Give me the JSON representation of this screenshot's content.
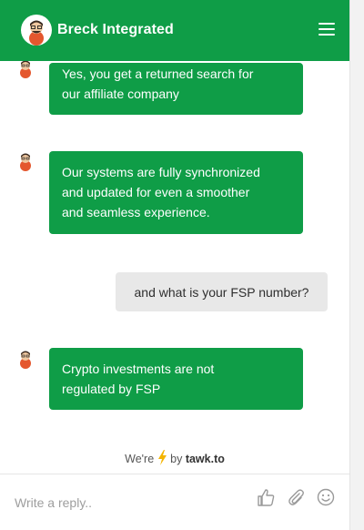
{
  "header": {
    "title": "Breck Integrated",
    "menu_icon": "hamburger-menu-icon"
  },
  "messages": [
    {
      "from": "agent",
      "text_lines": [
        "Yes, you get a returned search for",
        "our affiliate company"
      ]
    },
    {
      "from": "agent",
      "text_lines": [
        "Our systems are fully synchronized",
        "and updated for even a smoother",
        "and seamless experience."
      ]
    },
    {
      "from": "visitor",
      "text_lines": [
        "and what is your FSP  number?"
      ]
    },
    {
      "from": "agent",
      "text_lines": [
        "Crypto investments are  not",
        "regulated by FSP"
      ]
    }
  ],
  "powered_by": {
    "prefix": "We're",
    "by": "by",
    "brand": "tawk.to"
  },
  "composer": {
    "placeholder": "Write a reply..",
    "icons": [
      "thumbs-up-icon",
      "paperclip-icon",
      "emoji-icon"
    ]
  },
  "colors": {
    "brand_green": "#0f9d47",
    "visitor_bubble": "#e8e8e8"
  }
}
